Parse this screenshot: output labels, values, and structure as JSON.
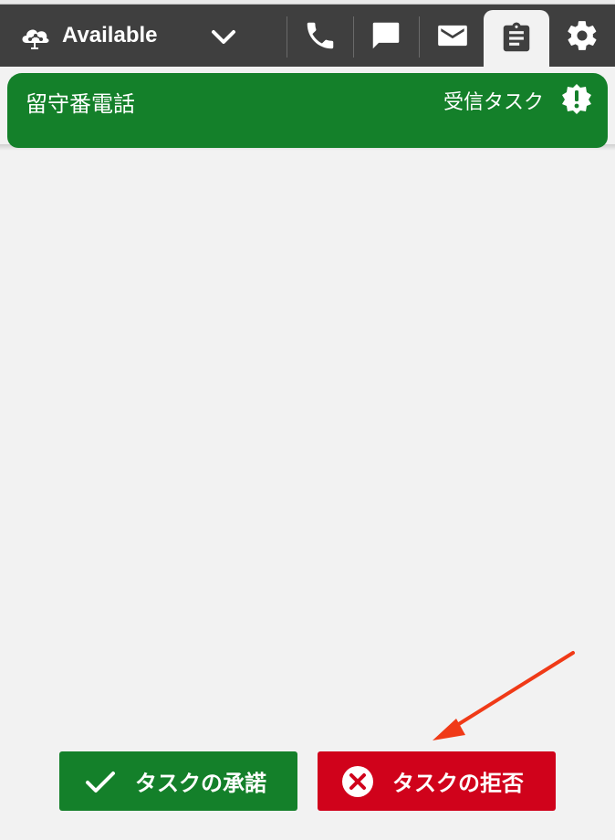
{
  "status": {
    "label": "Available",
    "icon": "cloud-network-icon"
  },
  "toolbar": {
    "icons": [
      "phone-icon",
      "chat-icon",
      "mail-icon",
      "clipboard-icon",
      "gear-icon"
    ],
    "active": "clipboard-icon"
  },
  "task": {
    "title": "留守番電話",
    "type_label": "受信タスク",
    "alert_icon": "alert-badge-icon",
    "header_color": "#14802a"
  },
  "actions": {
    "accept_label": "タスクの承諾",
    "reject_label": "タスクの拒否",
    "accept_color": "#14802a",
    "reject_color": "#d0021b"
  },
  "annotation": {
    "arrow_color": "#f03a17"
  }
}
